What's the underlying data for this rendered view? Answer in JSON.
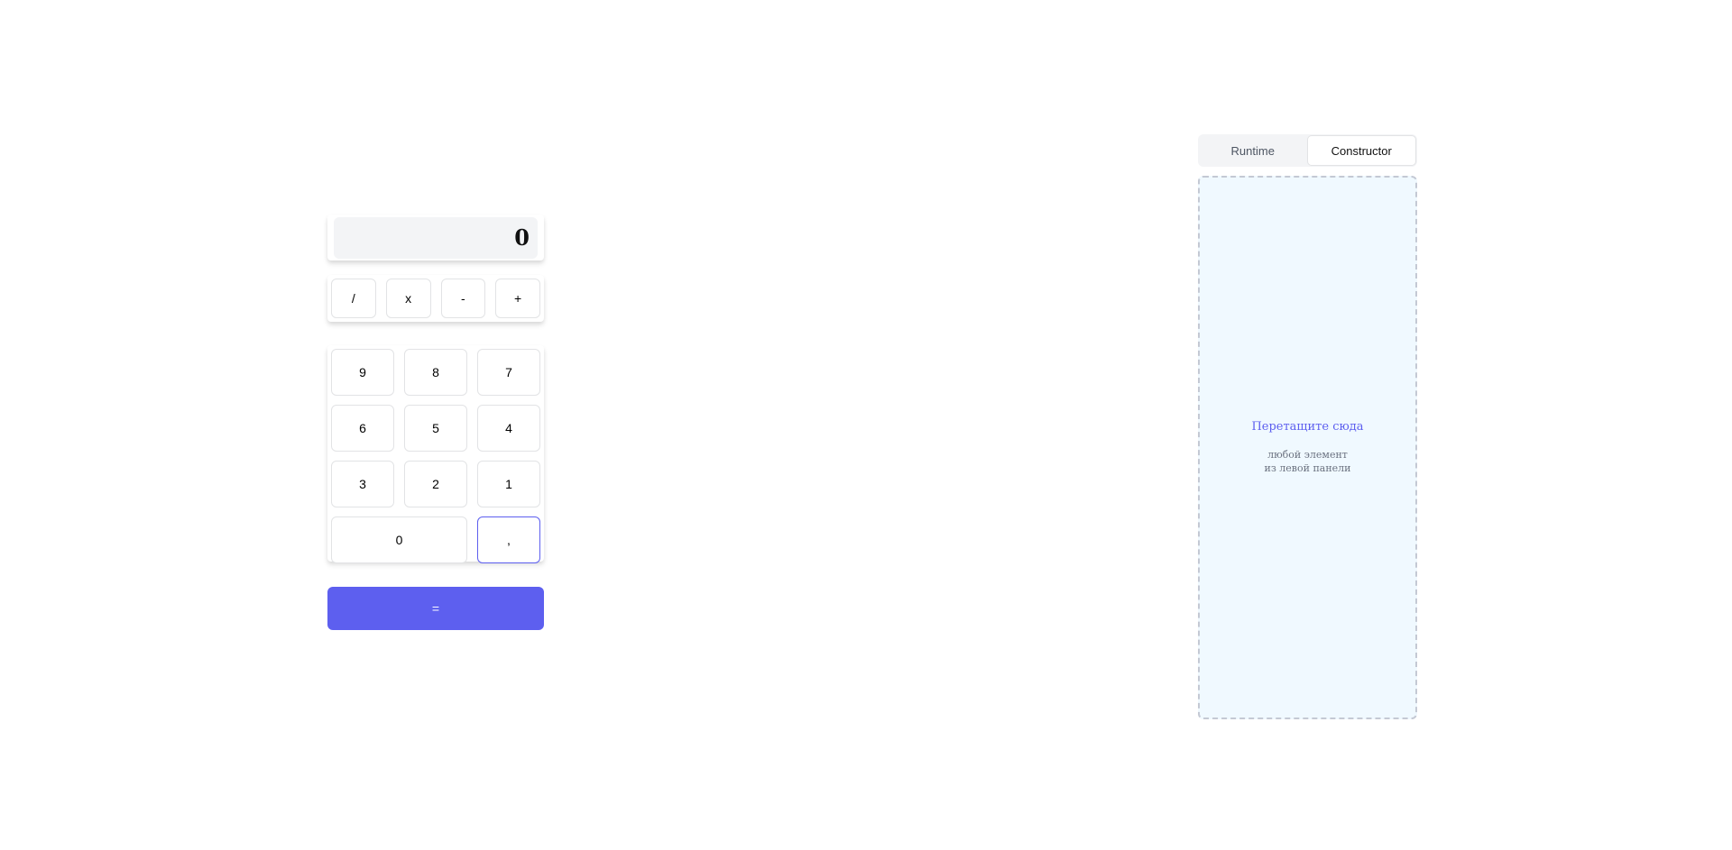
{
  "calculator": {
    "display_value": "0",
    "operators": [
      "/",
      "x",
      "-",
      "+"
    ],
    "digits": [
      "9",
      "8",
      "7",
      "6",
      "5",
      "4",
      "3",
      "2",
      "1"
    ],
    "zero_label": "0",
    "comma_label": ",",
    "equals_label": "="
  },
  "mode_switcher": {
    "runtime_label": "Runtime",
    "constructor_label": "Constructor",
    "active_tab": "constructor"
  },
  "drop_zone": {
    "title": "Перетащите сюда",
    "subtitle_line1": "любой элемент",
    "subtitle_line2": "из левой панели"
  },
  "colors": {
    "accent": "#5d5fef",
    "display_bg": "#f3f4f6",
    "drop_bg": "#f0f9ff",
    "drop_border": "#c4c9d4"
  }
}
